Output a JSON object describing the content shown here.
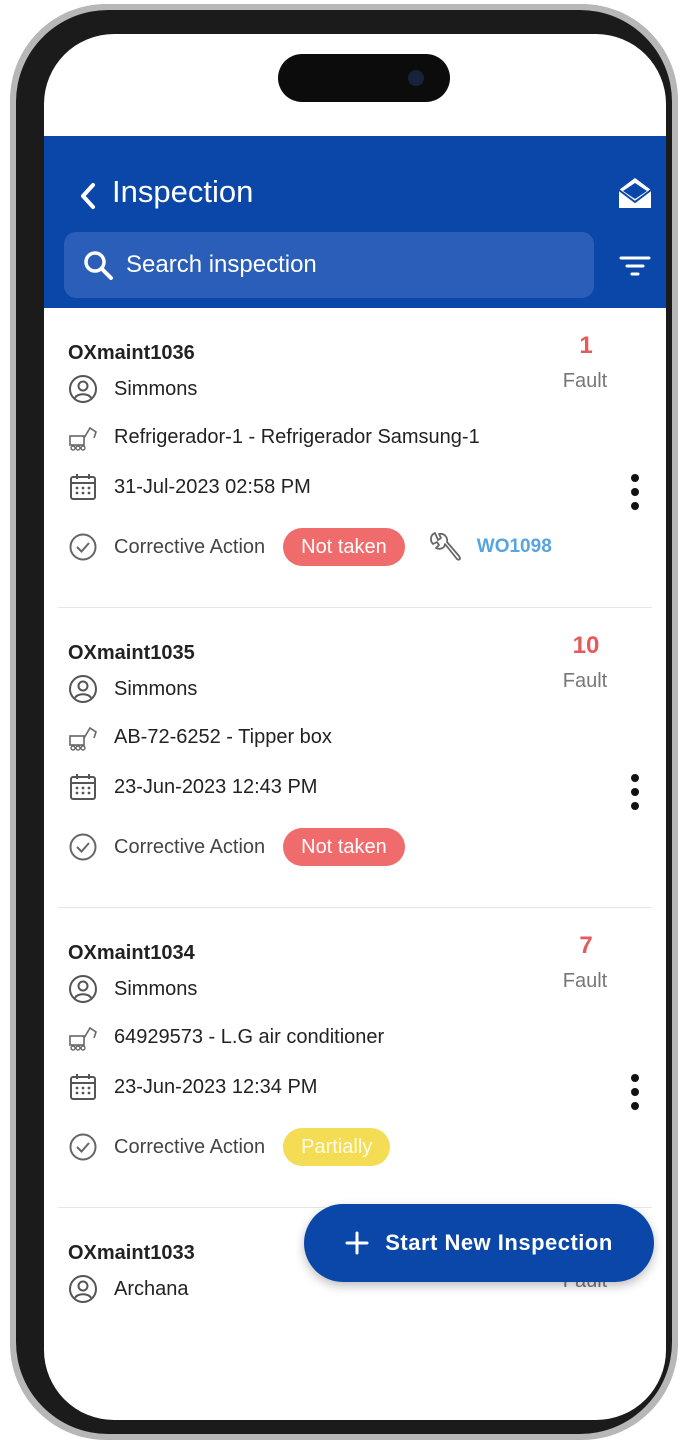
{
  "header": {
    "title": "Inspection",
    "search_placeholder": "Search inspection"
  },
  "inspections": [
    {
      "id": "OXmaint1036",
      "fault_count": "1",
      "fault_label": "Fault",
      "user": "Simmons",
      "asset": "Refrigerador-1 - Refrigerador Samsung-1",
      "datetime": "31-Jul-2023 02:58 PM",
      "action_label": "Corrective Action",
      "status": "Not taken",
      "work_order": "WO1098"
    },
    {
      "id": "OXmaint1035",
      "fault_count": "10",
      "fault_label": "Fault",
      "user": "Simmons",
      "asset": "AB-72-6252 - Tipper box",
      "datetime": "23-Jun-2023 12:43 PM",
      "action_label": "Corrective Action",
      "status": "Not taken"
    },
    {
      "id": "OXmaint1034",
      "fault_count": "7",
      "fault_label": "Fault",
      "user": "Simmons",
      "asset": "64929573 - L.G air conditioner",
      "datetime": "23-Jun-2023 12:34 PM",
      "action_label": "Corrective Action",
      "status": "Partially"
    },
    {
      "id": "OXmaint1033",
      "fault_count": "",
      "fault_label": "Fault",
      "user": "Archana"
    }
  ],
  "fab": {
    "label": "Start New Inspection"
  },
  "colors": {
    "header": "#0a47a9",
    "fault": "#e55a5a",
    "status_not_taken": "#f06b6b",
    "status_partially": "#f4dd55",
    "work_order_link": "#57a4e0"
  }
}
